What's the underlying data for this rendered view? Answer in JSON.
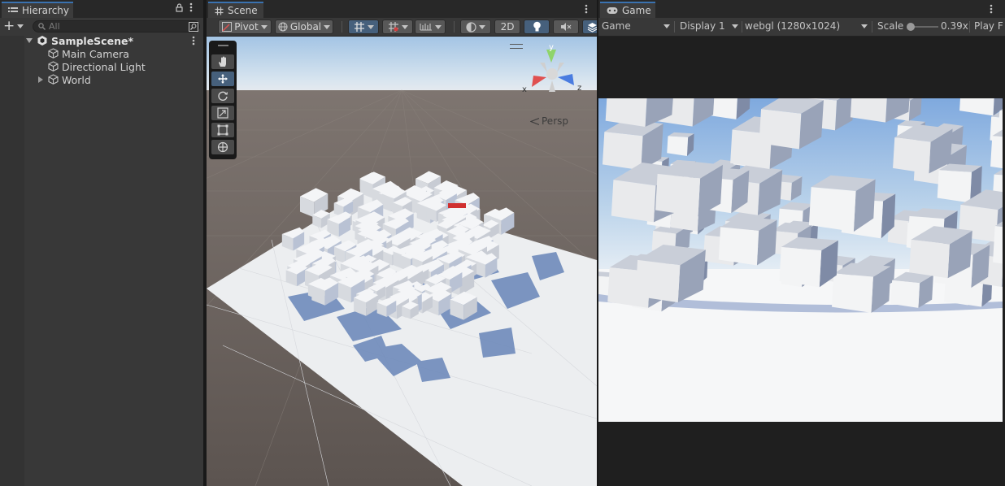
{
  "hierarchy": {
    "tab_label": "Hierarchy",
    "add_label": "+",
    "search_placeholder": "All",
    "scene_name": "SampleScene*",
    "items": [
      {
        "label": "Main Camera"
      },
      {
        "label": "Directional Light"
      },
      {
        "label": "World"
      }
    ]
  },
  "scene": {
    "tab_label": "Scene",
    "pivot_label": "Pivot",
    "global_label": "Global",
    "mode_2d_label": "2D",
    "persp_label": "Persp",
    "gizmo_axes": {
      "x": "x",
      "y": "y",
      "z": "z"
    }
  },
  "game": {
    "tab_label": "Game",
    "view_label": "Game",
    "display_label": "Display 1",
    "resolution_label": "webgl (1280x1024)",
    "scale_label": "Scale",
    "scale_value": "0.39x",
    "scale_fraction": 0.05,
    "play_label": "Play F"
  },
  "colors": {
    "accent": "#3a72b0",
    "panel": "#383838",
    "tabbar": "#282828",
    "sky": "#bcd6ec",
    "ground": "#6a625c",
    "cube": "#e6e7e9",
    "shadow": "#6c88b6"
  }
}
